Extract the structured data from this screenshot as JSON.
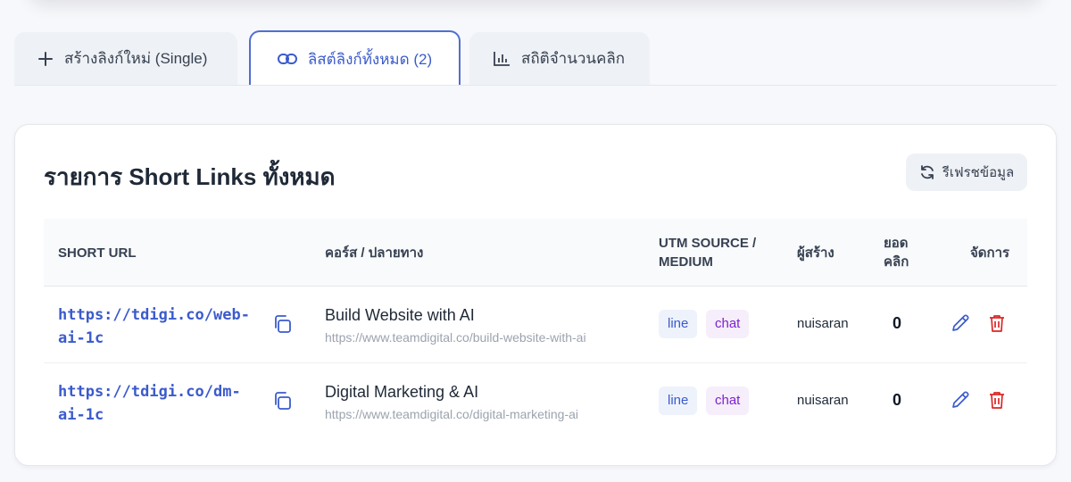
{
  "tabs": [
    {
      "label": "สร้างลิงก์ใหม่ (Single)",
      "icon": "plus-icon"
    },
    {
      "label": "ลิสต์ลิงก์ทั้งหมด (2)",
      "icon": "link-icon",
      "active": true
    },
    {
      "label": "สถิติจำนวนคลิก",
      "icon": "bar-chart-icon"
    }
  ],
  "panel": {
    "title": "รายการ Short Links ทั้งหมด",
    "refresh_label": "รีเฟรชข้อมูล"
  },
  "table": {
    "headers": {
      "short_url": "SHORT URL",
      "destination": "คอร์ส / ปลายทาง",
      "utm_line1": "UTM SOURCE /",
      "utm_line2": "MEDIUM",
      "creator": "ผู้สร้าง",
      "clicks_line1": "ยอด",
      "clicks_line2": "คลิก",
      "actions": "จัดการ"
    },
    "rows": [
      {
        "short_url_line1": "https://tdigi.co/web-",
        "short_url_line2": "ai-1c",
        "title": "Build Website with AI",
        "url": "https://www.teamdigital.co/build-website-with-ai",
        "utm_source": "line",
        "utm_medium": "chat",
        "creator": "nuisaran",
        "clicks": "0"
      },
      {
        "short_url_line1": "https://tdigi.co/dm-",
        "short_url_line2": "ai-1c",
        "title": "Digital Marketing & AI",
        "url": "https://www.teamdigital.co/digital-marketing-ai",
        "utm_source": "line",
        "utm_medium": "chat",
        "creator": "nuisaran",
        "clicks": "0"
      }
    ]
  },
  "colors": {
    "accent": "#3b5bcc",
    "danger": "#dc2626",
    "medium_badge": "#7e22ce"
  }
}
